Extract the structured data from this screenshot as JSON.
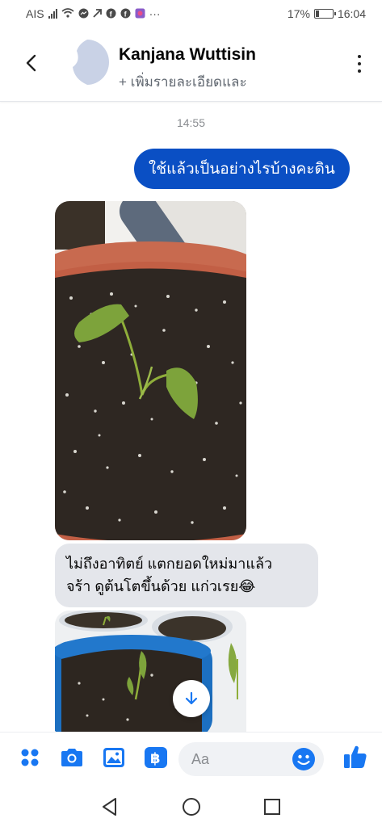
{
  "status_bar": {
    "carrier": "AIS",
    "battery_percent": "17%",
    "time": "16:04",
    "more": "···"
  },
  "header": {
    "contact_name": "Kanjana Wuttisin",
    "contact_subtitle": "+ เพิ่มรายละเอียดและ"
  },
  "chat": {
    "timestamp": "14:55",
    "outgoing_message": "ใช้แล้วเป็นอย่างไรบ้างคะดิน",
    "incoming_message": {
      "line1": "ไม่ถึงอาทิตย์ แตกยอดใหม่มาแล้ว",
      "line2": "จร้า ดูต้นโตขึ้นด้วย แก่วเรย😂"
    }
  },
  "composer": {
    "placeholder": "Aa",
    "icons": [
      "menu-dots-icon",
      "camera-icon",
      "gallery-icon",
      "payment-icon",
      "emoji-icon",
      "like-icon"
    ],
    "accent_color": "#1877f2"
  },
  "colors": {
    "outgoing_bubble": "#0a4fc4",
    "incoming_bubble": "#e4e6eb"
  }
}
